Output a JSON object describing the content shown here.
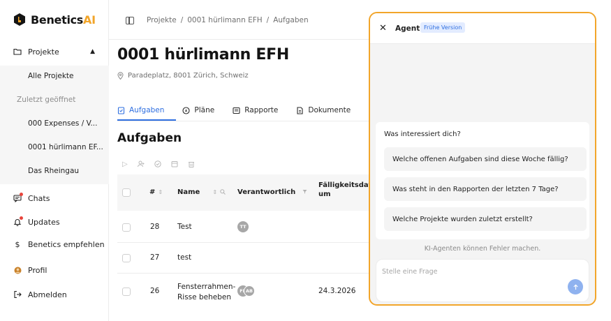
{
  "brand": {
    "name_prefix": "Benetics",
    "name_suffix": "AI"
  },
  "sidebar": {
    "projects": "Projekte",
    "all_projects": "Alle Projekte",
    "recent_label": "Zuletzt geöffnet",
    "recent": [
      "000 Expenses / V...",
      "0001 hürlimann EF...",
      "Das Rheingau"
    ],
    "chats": "Chats",
    "updates": "Updates",
    "recommend": "Benetics empfehlen",
    "profile": "Profil",
    "logout": "Abmelden"
  },
  "breadcrumb": {
    "root": "Projekte",
    "sep": "/",
    "project": "0001 hürlimann EFH",
    "page": "Aufgaben"
  },
  "project": {
    "title": "0001 hürlimann EFH",
    "address": "Paradeplatz, 8001 Zürich, Schweiz"
  },
  "tabs": [
    "Aufgaben",
    "Pläne",
    "Rapporte",
    "Dokumente"
  ],
  "section": {
    "title": "Aufgaben"
  },
  "table": {
    "headers": {
      "num": "#",
      "name": "Name",
      "owner": "Verantwortlich",
      "due_1": "Fälligkeitsdat",
      "due_2": "um"
    },
    "rows": [
      {
        "num": "28",
        "name": "Test",
        "avatars": [
          "TT"
        ],
        "due": ""
      },
      {
        "num": "27",
        "name": "test",
        "avatars": [],
        "due": ""
      },
      {
        "num": "26",
        "name_1": "Fensterrahmen-",
        "name_2": "Risse beheben",
        "avatars": [
          "FK",
          "AB"
        ],
        "due": "24.3.2026"
      }
    ]
  },
  "agent": {
    "title": "Agent",
    "badge": "Frühe Version",
    "question": "Was interessiert dich?",
    "suggestions": [
      "Welche offenen Aufgaben sind diese Woche fällig?",
      "Was steht in den Rapporten der letzten 7 Tage?",
      "Welche Projekte wurden zuletzt erstellt?"
    ],
    "disclaimer": "KI-Agenten können Fehler machen.",
    "placeholder": "Stelle eine Frage"
  },
  "colors": {
    "accent": "#2f6fe0",
    "brand": "#f2a52a",
    "alert": "#e8453c"
  }
}
